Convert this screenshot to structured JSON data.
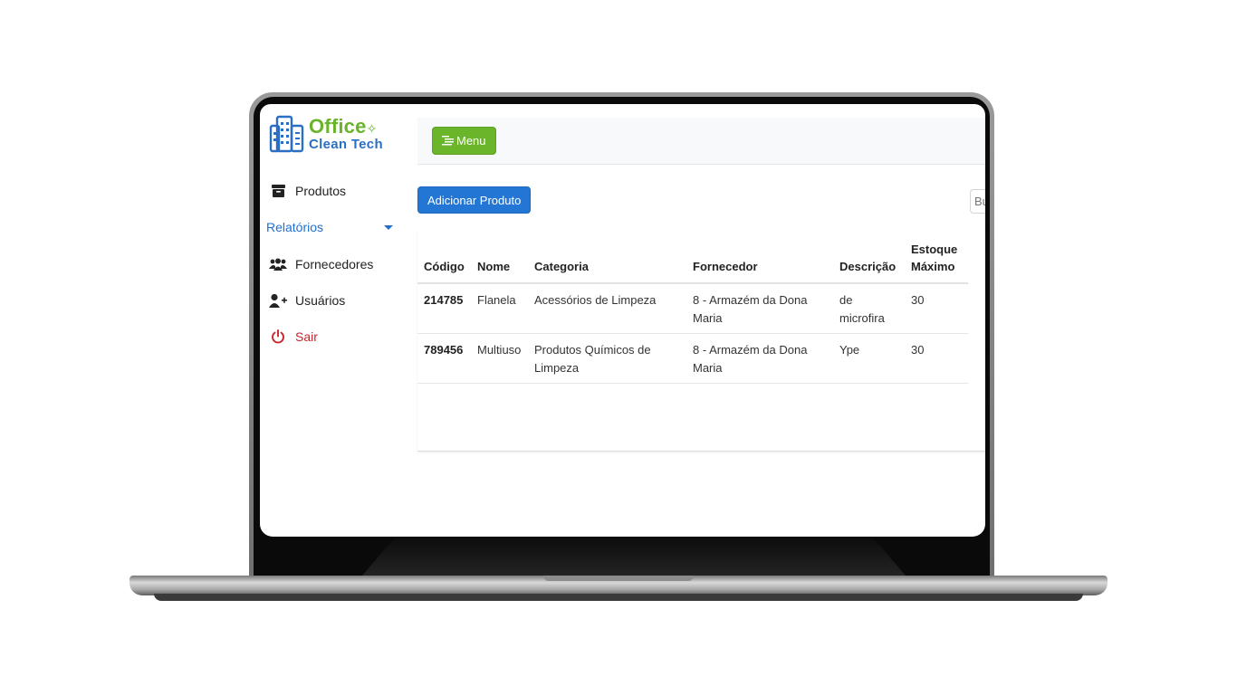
{
  "brand": {
    "name_line1": "Office",
    "name_line2": "Clean Tech",
    "accent_green": "#6ab42b",
    "accent_blue": "#2a6fc4"
  },
  "sidebar": {
    "items": [
      {
        "label": "Produtos",
        "icon": "archive-icon"
      },
      {
        "label": "Relatórios",
        "icon": "caret-down-icon"
      },
      {
        "label": "Fornecedores",
        "icon": "users-icon"
      },
      {
        "label": "Usuários",
        "icon": "user-plus-icon"
      },
      {
        "label": "Sair",
        "icon": "power-icon"
      }
    ]
  },
  "topbar": {
    "menu_label": "Menu"
  },
  "toolbar": {
    "add_label": "Adicionar Produto",
    "search_placeholder": "Buscar"
  },
  "table": {
    "headers": [
      "Código",
      "Nome",
      "Categoria",
      "Fornecedor",
      "Descrição",
      "Estoque Máximo"
    ],
    "rows": [
      [
        "214785",
        "Flanela",
        "Acessórios de Limpeza",
        "8 - Armazém da Dona Maria",
        "de microfira",
        "30"
      ],
      [
        "789456",
        "Multiuso",
        "Produtos Químicos de Limpeza",
        "8 - Armazém da Dona Maria",
        "Ype",
        "30"
      ]
    ]
  }
}
